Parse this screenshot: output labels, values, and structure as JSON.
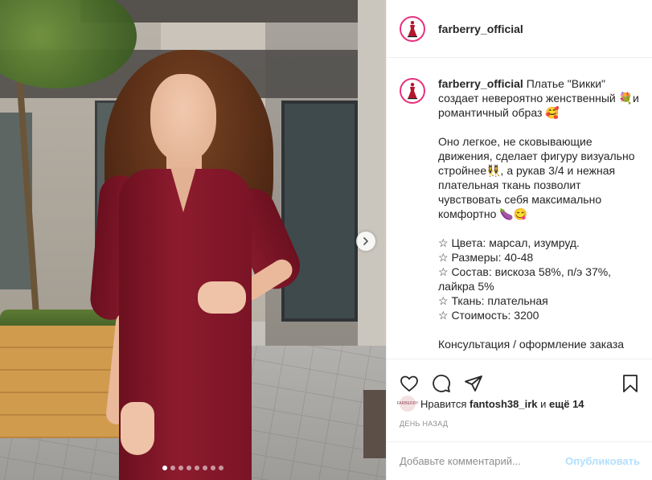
{
  "post": {
    "username": "farberry_official",
    "caption": {
      "username": "farberry_official",
      "text": " Платье \"Викки\" создает невероятно женственный 💐и романтичный образ 🥰\n\nОно легкое, не сковывающие движения, сделает фигуру визуально стройнее👯‍♀️, а рукав 3/4 и нежная плательная ткань позволит чувствовать себя максимально комфортно 🍆😋\n\n☆ Цвета: марсал, изумруд.\n☆ Размеры: 40-48\n☆ Состав: вискоза 58%, п/э 37%, лайкра 5%\n☆ Ткань: плательная\n☆ Стоимость: 3200\n\nКонсультация / оформление заказа"
    },
    "likes": {
      "avatar_text": "FARBERRY",
      "prefix": "Нравится ",
      "user": "fantosh38_irk",
      "middle": " и ",
      "others": "ещё 14"
    },
    "time": "ДЕНЬ НАЗАД",
    "comment": {
      "placeholder": "Добавьте комментарий...",
      "publish": "Опубликовать"
    },
    "carousel": {
      "total": 8,
      "active_index": 0
    }
  },
  "icons": {
    "like": "heart-icon",
    "comment": "comment-icon",
    "share": "share-icon",
    "save": "bookmark-icon",
    "next": "chevron-right-icon",
    "avatar": "dress-logo-icon"
  },
  "colors": {
    "avatar_ring": "#e8327c",
    "publish_disabled": "#b2dffc",
    "muted": "#8e8e8e",
    "text": "#262626"
  }
}
